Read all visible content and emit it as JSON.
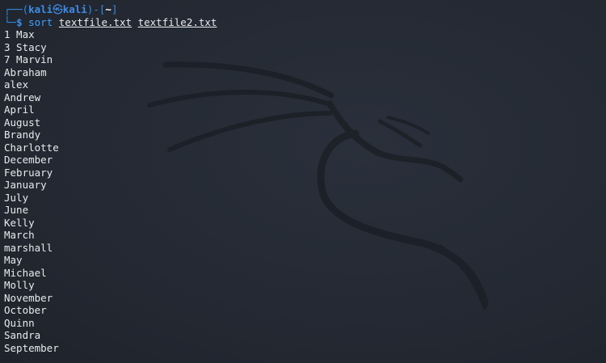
{
  "prompt": {
    "corner_top": "┌──(",
    "user": "kali",
    "at_symbol": "㉿",
    "host": "kali",
    "bracket_mid": ")-[",
    "dir": "~",
    "bracket_end": "]",
    "corner_bottom": "└─",
    "dollar": "$"
  },
  "command": {
    "name": "sort",
    "args": [
      "textfile.txt",
      "textfile2.txt"
    ]
  },
  "output": [
    "1 Max",
    "3 Stacy",
    "7 Marvin",
    "Abraham",
    "alex",
    "Andrew",
    "April",
    "August",
    "Brandy",
    "Charlotte",
    "December",
    "February",
    "January",
    "July",
    "June",
    "Kelly",
    "March",
    "marshall",
    "May",
    "Michael",
    "Molly",
    "November",
    "October",
    "Quinn",
    "Sandra",
    "September"
  ],
  "colors": {
    "background": "#252a34",
    "prompt_blue": "#2f8de4",
    "command_blue": "#3fa2ff",
    "text": "#e8eaed"
  }
}
